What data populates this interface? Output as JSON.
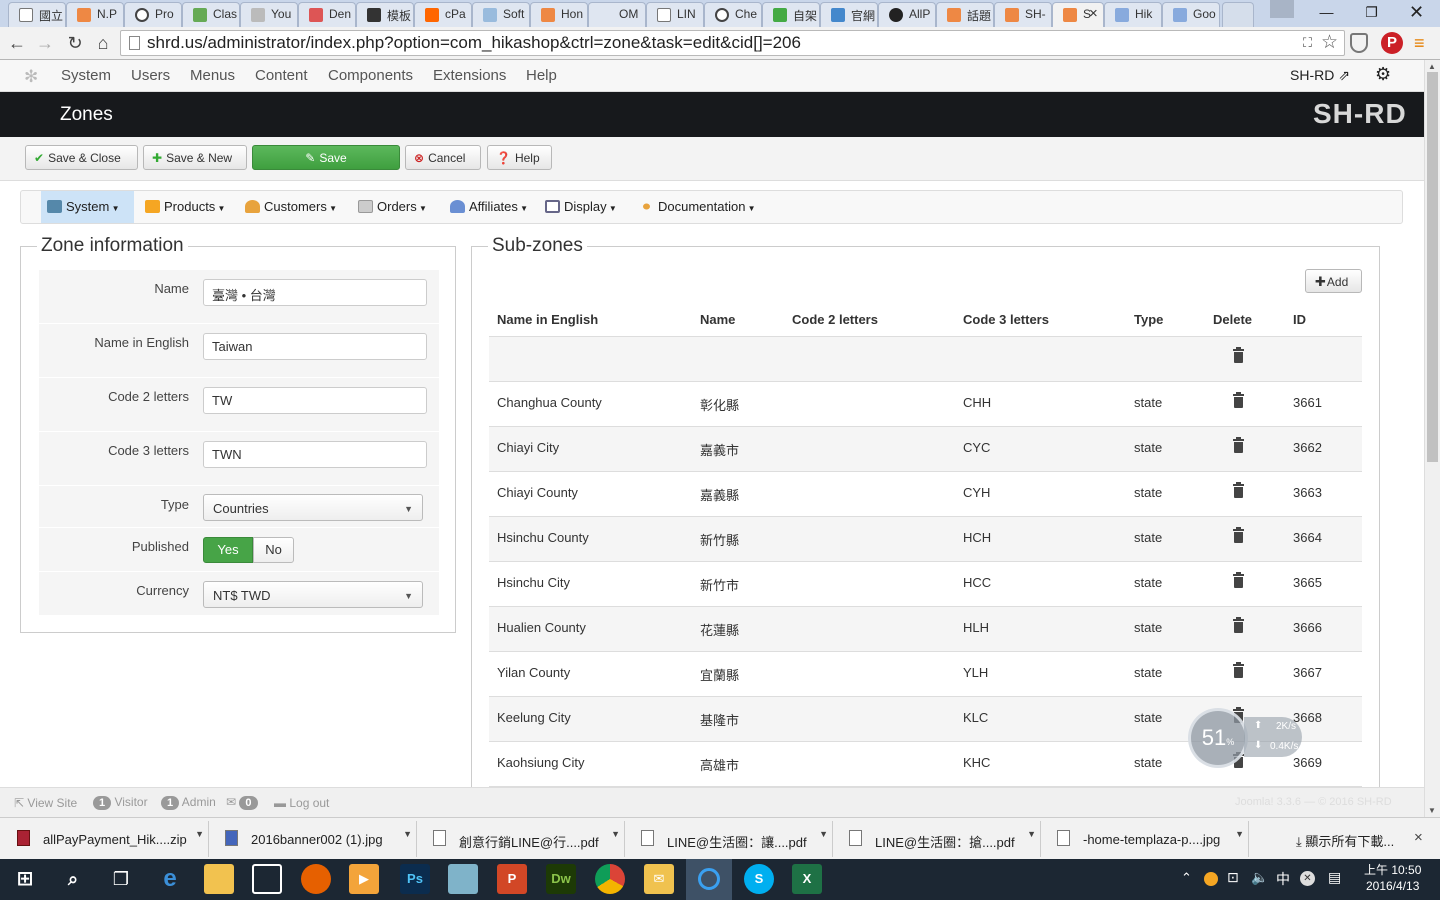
{
  "browser": {
    "tabs": [
      "國立",
      "N.P",
      "Pro",
      "Clas",
      "You",
      "Den",
      "模板",
      "cPa",
      "Soft",
      "Hon",
      "OM",
      "LIN",
      "Che",
      "自架",
      "官網",
      "AllP",
      "話題",
      "SH-",
      "S",
      "Hik",
      "Goo"
    ],
    "active_tab_close": "×",
    "url": "shrd.us/administrator/index.php?option=com_hikashop&ctrl=zone&task=edit&cid[]=206"
  },
  "joomla_menu": {
    "items": [
      "System",
      "Users",
      "Menus",
      "Content",
      "Components",
      "Extensions",
      "Help"
    ],
    "site_name": "SH-RD"
  },
  "header": {
    "title": "Zones",
    "logo": "SH-RD"
  },
  "toolbar": {
    "save_close": "Save & Close",
    "save_new": "Save & New",
    "save": "Save",
    "cancel": "Cancel",
    "help": "Help"
  },
  "hika_menu": {
    "items": [
      "System",
      "Products",
      "Customers",
      "Orders",
      "Affiliates",
      "Display",
      "Documentation"
    ]
  },
  "zone_info": {
    "legend": "Zone information",
    "name_label": "Name",
    "name_value": "臺灣 • 台灣",
    "name_en_label": "Name in English",
    "name_en_value": "Taiwan",
    "code2_label": "Code 2 letters",
    "code2_value": "TW",
    "code3_label": "Code 3 letters",
    "code3_value": "TWN",
    "type_label": "Type",
    "type_value": "Countries",
    "published_label": "Published",
    "published_yes": "Yes",
    "published_no": "No",
    "published_value": "Yes",
    "currency_label": "Currency",
    "currency_value": "NT$ TWD"
  },
  "subzones": {
    "legend": "Sub-zones",
    "add_label": "Add",
    "columns": [
      "Name in English",
      "Name",
      "Code 2 letters",
      "Code 3 letters",
      "Type",
      "Delete",
      "ID"
    ],
    "rows": [
      {
        "name_en": "Changhua County",
        "name": "彰化縣",
        "code2": "",
        "code3": "CHH",
        "type": "state",
        "id": "3661"
      },
      {
        "name_en": "Chiayi City",
        "name": "嘉義市",
        "code2": "",
        "code3": "CYC",
        "type": "state",
        "id": "3662"
      },
      {
        "name_en": "Chiayi County",
        "name": "嘉義縣",
        "code2": "",
        "code3": "CYH",
        "type": "state",
        "id": "3663"
      },
      {
        "name_en": "Hsinchu County",
        "name": "新竹縣",
        "code2": "",
        "code3": "HCH",
        "type": "state",
        "id": "3664"
      },
      {
        "name_en": "Hsinchu City",
        "name": "新竹市",
        "code2": "",
        "code3": "HCC",
        "type": "state",
        "id": "3665"
      },
      {
        "name_en": "Hualien County",
        "name": "花蓮縣",
        "code2": "",
        "code3": "HLH",
        "type": "state",
        "id": "3666"
      },
      {
        "name_en": "Yilan County",
        "name": "宜蘭縣",
        "code2": "",
        "code3": "YLH",
        "type": "state",
        "id": "3667"
      },
      {
        "name_en": "Keelung City",
        "name": "基隆市",
        "code2": "",
        "code3": "KLC",
        "type": "state",
        "id": "3668"
      },
      {
        "name_en": "Kaohsiung City",
        "name": "高雄市",
        "code2": "",
        "code3": "KHC",
        "type": "state",
        "id": "3669"
      }
    ]
  },
  "status_bar": {
    "view_site": "View Site",
    "visitor_count": "1",
    "visitor_label": "Visitor",
    "admin_count": "1",
    "admin_label": "Admin",
    "messages_count": "0",
    "logout": "Log out",
    "footer": "Joomla! 3.3.6 — © 2016 SH-RD"
  },
  "net_widget": {
    "percent": "51",
    "percent_unit": "%",
    "up": "2K/s",
    "down": "0.4K/s"
  },
  "downloads": {
    "items": [
      "allPayPayment_Hik....zip",
      "2016banner002 (1).jpg",
      "創意行銷LINE@行....pdf",
      "LINE@生活圈：讓....pdf",
      "LINE@生活圈：搶....pdf",
      "-home-templaza-p....jpg"
    ],
    "show_all": "顯示所有下載...",
    "close": "×"
  },
  "taskbar": {
    "time": "上午 10:50",
    "date": "2016/4/13"
  },
  "colors": {
    "green": "#47a447",
    "header_bg": "#17191c",
    "active_menu": "#cde3f7"
  }
}
